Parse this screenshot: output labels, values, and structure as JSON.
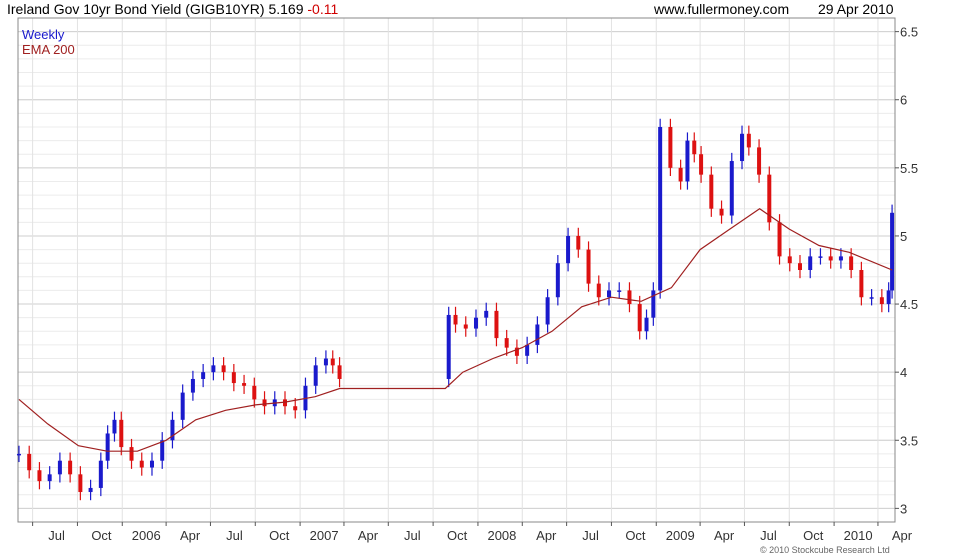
{
  "header": {
    "title": "Ireland Gov 10yr Bond Yield (GIGB10YR) 5.169",
    "change": "-0.11",
    "site": "www.fullermoney.com",
    "date": "29 Apr 2010"
  },
  "legend": {
    "weekly": "Weekly",
    "ema": "EMA 200"
  },
  "copyright": "© 2010 Stockcube Research Ltd",
  "colors": {
    "up": "#1a1acc",
    "down": "#dd1111",
    "ema": "#a02020",
    "grid": "#d8d8d8"
  },
  "chart_data": {
    "type": "line",
    "title": "Ireland Gov 10yr Bond Yield (GIGB10YR)",
    "ylim": [
      2.9,
      6.6
    ],
    "yticks": [
      3,
      3.5,
      4,
      4.5,
      5,
      5.5,
      6,
      6.5
    ],
    "x_range": [
      "2005-06-01",
      "2010-05-06"
    ],
    "x_ticks": [
      {
        "date": "2005-07-01",
        "label": "Jul"
      },
      {
        "date": "2005-10-01",
        "label": "Oct"
      },
      {
        "date": "2006-01-01",
        "label": "2006"
      },
      {
        "date": "2006-04-01",
        "label": "Apr"
      },
      {
        "date": "2006-07-01",
        "label": "Jul"
      },
      {
        "date": "2006-10-01",
        "label": "Oct"
      },
      {
        "date": "2007-01-01",
        "label": "2007"
      },
      {
        "date": "2007-04-01",
        "label": "Apr"
      },
      {
        "date": "2007-07-01",
        "label": "Jul"
      },
      {
        "date": "2007-10-01",
        "label": "Oct"
      },
      {
        "date": "2008-01-01",
        "label": "2008"
      },
      {
        "date": "2008-04-01",
        "label": "Apr"
      },
      {
        "date": "2008-07-01",
        "label": "Jul"
      },
      {
        "date": "2008-10-01",
        "label": "Oct"
      },
      {
        "date": "2009-01-01",
        "label": "2009"
      },
      {
        "date": "2009-04-01",
        "label": "Apr"
      },
      {
        "date": "2009-07-01",
        "label": "Jul"
      },
      {
        "date": "2009-10-01",
        "label": "Oct"
      },
      {
        "date": "2010-01-01",
        "label": "2010"
      },
      {
        "date": "2010-04-01",
        "label": "Apr"
      }
    ],
    "grid": true,
    "series": [
      {
        "name": "Weekly",
        "points": [
          [
            "2005-06-03",
            3.4
          ],
          [
            "2005-06-24",
            3.28
          ],
          [
            "2005-07-15",
            3.2
          ],
          [
            "2005-08-05",
            3.25
          ],
          [
            "2005-08-26",
            3.35
          ],
          [
            "2005-09-16",
            3.25
          ],
          [
            "2005-10-07",
            3.12
          ],
          [
            "2005-10-28",
            3.15
          ],
          [
            "2005-11-18",
            3.35
          ],
          [
            "2005-12-02",
            3.55
          ],
          [
            "2005-12-16",
            3.65
          ],
          [
            "2005-12-30",
            3.45
          ],
          [
            "2006-01-20",
            3.35
          ],
          [
            "2006-02-10",
            3.3
          ],
          [
            "2006-03-03",
            3.35
          ],
          [
            "2006-03-24",
            3.5
          ],
          [
            "2006-04-14",
            3.65
          ],
          [
            "2006-05-05",
            3.85
          ],
          [
            "2006-05-26",
            3.95
          ],
          [
            "2006-06-16",
            4.0
          ],
          [
            "2006-07-07",
            4.05
          ],
          [
            "2006-07-28",
            4.0
          ],
          [
            "2006-08-18",
            3.92
          ],
          [
            "2006-09-08",
            3.9
          ],
          [
            "2006-09-29",
            3.8
          ],
          [
            "2006-10-20",
            3.75
          ],
          [
            "2006-11-10",
            3.8
          ],
          [
            "2006-12-01",
            3.75
          ],
          [
            "2006-12-22",
            3.72
          ],
          [
            "2007-01-12",
            3.9
          ],
          [
            "2007-02-02",
            4.05
          ],
          [
            "2007-02-23",
            4.1
          ],
          [
            "2007-03-09",
            4.05
          ],
          [
            "2007-03-23",
            3.95
          ],
          [
            "2007-11-02",
            4.42
          ],
          [
            "2007-11-16",
            4.35
          ],
          [
            "2007-12-07",
            4.32
          ],
          [
            "2007-12-28",
            4.4
          ],
          [
            "2008-01-18",
            4.45
          ],
          [
            "2008-02-08",
            4.25
          ],
          [
            "2008-02-29",
            4.18
          ],
          [
            "2008-03-21",
            4.12
          ],
          [
            "2008-04-11",
            4.2
          ],
          [
            "2008-05-02",
            4.35
          ],
          [
            "2008-05-23",
            4.55
          ],
          [
            "2008-06-13",
            4.8
          ],
          [
            "2008-07-04",
            5.0
          ],
          [
            "2008-07-25",
            4.9
          ],
          [
            "2008-08-15",
            4.65
          ],
          [
            "2008-09-05",
            4.55
          ],
          [
            "2008-09-26",
            4.6
          ],
          [
            "2008-10-17",
            4.6
          ],
          [
            "2008-11-07",
            4.5
          ],
          [
            "2008-11-28",
            4.3
          ],
          [
            "2008-12-12",
            4.4
          ],
          [
            "2008-12-26",
            4.6
          ],
          [
            "2009-01-09",
            5.8
          ],
          [
            "2009-01-30",
            5.5
          ],
          [
            "2009-02-20",
            5.4
          ],
          [
            "2009-03-06",
            5.7
          ],
          [
            "2009-03-20",
            5.6
          ],
          [
            "2009-04-03",
            5.45
          ],
          [
            "2009-04-24",
            5.2
          ],
          [
            "2009-05-15",
            5.15
          ],
          [
            "2009-06-05",
            5.55
          ],
          [
            "2009-06-26",
            5.75
          ],
          [
            "2009-07-10",
            5.65
          ],
          [
            "2009-07-31",
            5.45
          ],
          [
            "2009-08-21",
            5.1
          ],
          [
            "2009-09-11",
            4.85
          ],
          [
            "2009-10-02",
            4.8
          ],
          [
            "2009-10-23",
            4.75
          ],
          [
            "2009-11-13",
            4.85
          ],
          [
            "2009-12-04",
            4.85
          ],
          [
            "2009-12-25",
            4.82
          ],
          [
            "2010-01-15",
            4.85
          ],
          [
            "2010-02-05",
            4.75
          ],
          [
            "2010-02-26",
            4.55
          ],
          [
            "2010-03-19",
            4.55
          ],
          [
            "2010-04-09",
            4.5
          ],
          [
            "2010-04-23",
            4.6
          ],
          [
            "2010-04-30",
            5.17
          ]
        ]
      },
      {
        "name": "EMA 200",
        "points": [
          [
            "2005-06-03",
            3.8
          ],
          [
            "2005-08-01",
            3.62
          ],
          [
            "2005-10-03",
            3.46
          ],
          [
            "2005-12-01",
            3.42
          ],
          [
            "2006-02-01",
            3.42
          ],
          [
            "2006-04-01",
            3.5
          ],
          [
            "2006-06-01",
            3.65
          ],
          [
            "2006-08-01",
            3.72
          ],
          [
            "2006-10-01",
            3.76
          ],
          [
            "2006-12-01",
            3.78
          ],
          [
            "2007-02-01",
            3.82
          ],
          [
            "2007-03-23",
            3.88
          ],
          [
            "2007-10-26",
            3.88
          ],
          [
            "2007-12-01",
            4.0
          ],
          [
            "2008-02-01",
            4.1
          ],
          [
            "2008-04-01",
            4.18
          ],
          [
            "2008-06-01",
            4.3
          ],
          [
            "2008-08-01",
            4.48
          ],
          [
            "2008-10-01",
            4.55
          ],
          [
            "2008-12-01",
            4.52
          ],
          [
            "2009-02-01",
            4.62
          ],
          [
            "2009-04-01",
            4.9
          ],
          [
            "2009-06-01",
            5.05
          ],
          [
            "2009-08-01",
            5.2
          ],
          [
            "2009-10-01",
            5.05
          ],
          [
            "2009-12-01",
            4.93
          ],
          [
            "2010-02-01",
            4.88
          ],
          [
            "2010-04-30",
            4.75
          ]
        ]
      }
    ]
  }
}
